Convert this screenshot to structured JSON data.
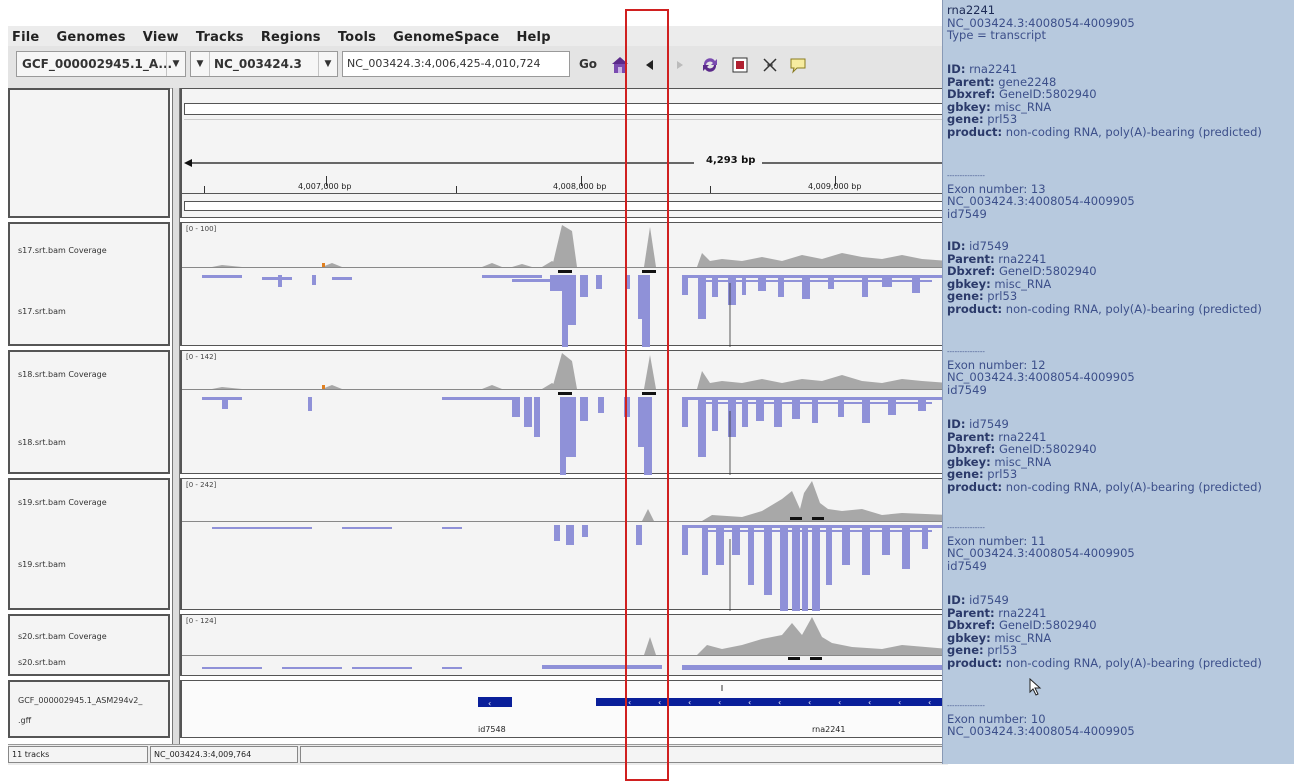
{
  "menu": {
    "file": "File",
    "genomes": "Genomes",
    "view": "View",
    "tracks": "Tracks",
    "regions": "Regions",
    "tools": "Tools",
    "genomespace": "GenomeSpace",
    "help": "Help"
  },
  "toolbar": {
    "genome": "GCF_000002945.1_A...",
    "chromosome": "NC_003424.3",
    "locus": "NC_003424.3:4,006,425-4,010,724",
    "go": "Go"
  },
  "ruler": {
    "span": "4,293 bp",
    "ticks": [
      "4,007,000 bp",
      "4,008,000 bp",
      "4,009,000 bp"
    ]
  },
  "tracks": [
    {
      "coverage_name": "s17.srt.bam Coverage",
      "reads_name": "s17.srt.bam",
      "range": "[0 - 100]"
    },
    {
      "coverage_name": "s18.srt.bam Coverage",
      "reads_name": "s18.srt.bam",
      "range": "[0 - 142]"
    },
    {
      "coverage_name": "s19.srt.bam Coverage",
      "reads_name": "s19.srt.bam",
      "range": "[0 - 242]"
    },
    {
      "coverage_name": "s20.srt.bam Coverage",
      "reads_name": "s20.srt.bam",
      "range": "[0 - 124]"
    }
  ],
  "annotation": {
    "name_line1": "GCF_000002945.1_ASM294v2_",
    "name_line2": ".gff",
    "feature1": "id7548",
    "feature2": "rna2241"
  },
  "status": {
    "tracks": "11 tracks",
    "position": "NC_003424.3:4,009,764"
  },
  "popup": {
    "title": "rna2241",
    "coords": "NC_003424.3:4008054-4009905",
    "type": "Type = transcript",
    "main": {
      "id_label": "ID:",
      "id": "rna2241",
      "parent_label": "Parent:",
      "parent": "gene2248",
      "dbxref_label": "Dbxref:",
      "dbxref": "GeneID:5802940",
      "gbkey_label": "gbkey:",
      "gbkey": "misc_RNA",
      "gene_label": "gene:",
      "gene": "prl53",
      "product_label": "product:",
      "product": "non-coding RNA, poly(A)-bearing (predicted)"
    },
    "separator": "---------------",
    "exons": [
      {
        "number": "Exon number: 13",
        "coords": "NC_003424.3:4008054-4009905",
        "id": "id7549"
      },
      {
        "number": "Exon number: 12",
        "coords": "NC_003424.3:4008054-4009905",
        "id": "id7549"
      },
      {
        "number": "Exon number: 11",
        "coords": "NC_003424.3:4008054-4009905",
        "id": "id7549"
      },
      {
        "number": "Exon number: 10",
        "coords": "NC_003424.3:4008054-4009905"
      }
    ],
    "exon_attrs": {
      "id_label": "ID:",
      "id": "id7549",
      "parent_label": "Parent:",
      "parent": "rna2241",
      "dbxref_label": "Dbxref:",
      "dbxref": "GeneID:5802940",
      "gbkey_label": "gbkey:",
      "gbkey": "misc_RNA",
      "gene_label": "gene:",
      "gene": "prl53",
      "product_label": "product:",
      "product": "non-coding RNA, poly(A)-bearing (predicted)"
    }
  },
  "colors": {
    "reads": "#8f91d8",
    "coverage": "#a8a8a8",
    "feature": "#0a1f9a",
    "popup_bg": "#b7c9de",
    "highlight": "#d02020"
  }
}
